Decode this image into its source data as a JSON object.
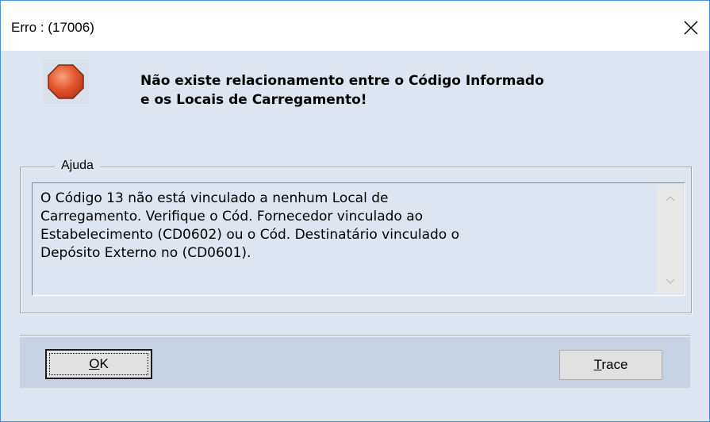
{
  "window": {
    "title": "Erro : (17006)",
    "close_glyph": "✕"
  },
  "icon": {
    "name": "stop-error-icon",
    "color": "#e0502a"
  },
  "message": {
    "line1": "Não existe relacionamento entre o Código Informado",
    "line2": "e os Locais de Carregamento!"
  },
  "help": {
    "label": "Ajuda",
    "lines": [
      "O Código 13 não está vinculado a nenhum Local de",
      "Carregamento. Verifique o Cód. Fornecedor vinculado ao",
      "Estabelecimento (CD0602) ou o Cód. Destinatário vinculado o",
      "Depósito Externo no (CD0601)."
    ]
  },
  "buttons": {
    "ok": {
      "mnemonic": "O",
      "rest": "K"
    },
    "trace": {
      "mnemonic": "T",
      "rest": "race"
    }
  },
  "colors": {
    "border": "#4a90d9",
    "background": "#dde6f0",
    "button_bar": "#c7d3e2"
  }
}
